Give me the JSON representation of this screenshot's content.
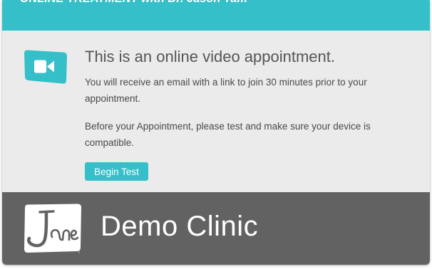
{
  "header": {
    "title": "ONLINE TREATMENT with Dr. Jason Tam"
  },
  "appointment": {
    "icon": "video-camera-icon",
    "title": "This is an online video appointment.",
    "email_notice": "You will receive an email with a link to join 30 minutes prior to your appointment.",
    "test_notice": "Before your Appointment, please test and make sure your device is compatible.",
    "test_button_label": "Begin Test"
  },
  "footer": {
    "logo_text": "Jane",
    "clinic_name": "Demo Clinic"
  },
  "colors": {
    "accent": "#35bfc9",
    "content_background": "#ebebeb",
    "footer_background": "#626262"
  }
}
